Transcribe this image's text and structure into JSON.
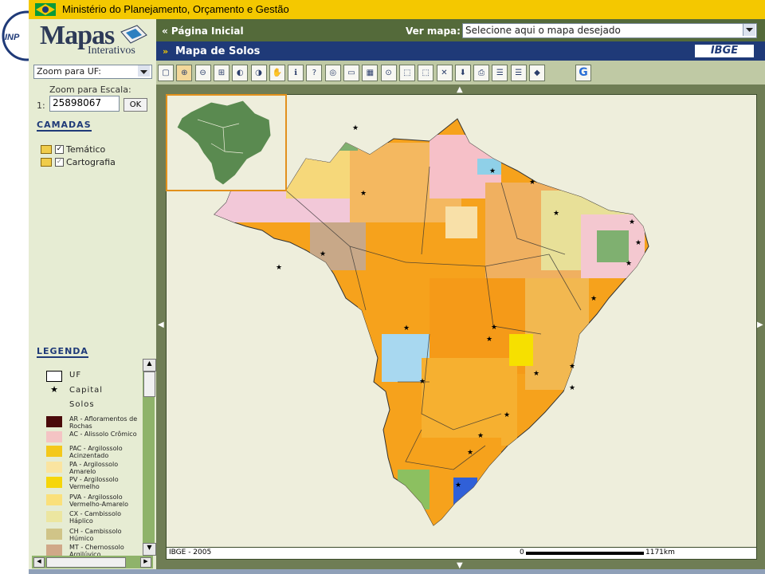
{
  "header": {
    "title": "Ministério do Planejamento, Orçamento e Gestão"
  },
  "brand": {
    "name": "Mapas",
    "subtitle": "Interativos",
    "left_logo": "INPE",
    "right_logo": "IBGE"
  },
  "nav": {
    "home_link": "« Página Inicial",
    "map_label": "Ver mapa:",
    "map_select_placeholder": "Selecione aqui o mapa desejado"
  },
  "map_title": {
    "icon": "»",
    "text": "Mapa de Solos"
  },
  "sidebar": {
    "zoom_uf_label": "Zoom para UF:",
    "zoom_scale_label": "Zoom para Escala:",
    "scale_prefix": "1:",
    "scale_value": "25898067",
    "ok_label": "OK",
    "layers_header": "CAMADAS",
    "layers": [
      {
        "label": "Temático"
      },
      {
        "label": "Cartografia"
      }
    ],
    "legend_header": "LEGENDA",
    "legend": [
      {
        "label": "UF",
        "type": "outline",
        "color": "#ffffff"
      },
      {
        "label": "Capital",
        "type": "star",
        "color": "#000000"
      },
      {
        "label": "Solos",
        "type": "text",
        "color": ""
      },
      {
        "label": "AR - Afloramentos de Rochas",
        "type": "fill",
        "color": "#4a0a0a"
      },
      {
        "label": "AC - Alissolo Crômico",
        "type": "fill",
        "color": "#f4c4c4"
      },
      {
        "label": "PAC - Argilossolo Acinzentado",
        "type": "fill",
        "color": "#f4c81a"
      },
      {
        "label": "PA - Argilossolo Amarelo",
        "type": "fill",
        "color": "#fae4a0"
      },
      {
        "label": "PV - Argilossolo Vermelho",
        "type": "fill",
        "color": "#f6d60a"
      },
      {
        "label": "PVA - Argilossolo Vermelho-Amarelo",
        "type": "fill",
        "color": "#fae07a"
      },
      {
        "label": "CX - Cambissolo Háplico",
        "type": "fill",
        "color": "#ece6a0"
      },
      {
        "label": "CH - Cambissolo Húmico",
        "type": "fill",
        "color": "#d0c488"
      },
      {
        "label": "MT - Chernossolo Argilúvico",
        "type": "fill",
        "color": "#d0a888"
      }
    ]
  },
  "map": {
    "credit": "IBGE - 2005",
    "scale_min": "0",
    "scale_max": "1171km"
  },
  "toolbar_icons": [
    "full-extent-icon",
    "zoom-in-icon",
    "zoom-out-icon",
    "zoom-box-icon",
    "zoom-previous-icon",
    "zoom-next-icon",
    "pan-hand-icon",
    "info-icon",
    "help-icon",
    "binoculars-icon",
    "measure-icon",
    "layers-icon",
    "center-icon",
    "select-icon",
    "select-box-icon",
    "clear-selection-icon",
    "download-icon",
    "print-icon",
    "report-icon",
    "report2-icon",
    "export-icon",
    "google-icon"
  ],
  "colors": {
    "accent": "#1f3a78",
    "header": "#f4c800",
    "nav": "#546a3a",
    "sidebar": "#e6ecd3",
    "map_background": "#eeeedc",
    "orange": "#f6a21c"
  }
}
